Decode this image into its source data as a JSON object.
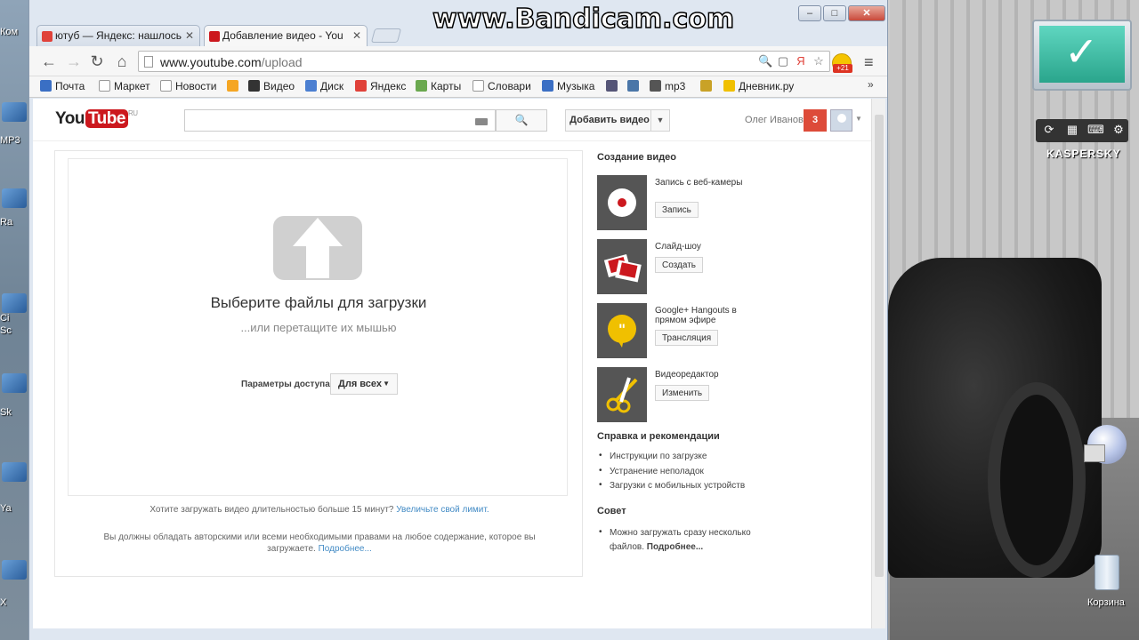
{
  "watermark": "www.Bandicam.com",
  "browser": {
    "tabs": [
      {
        "label": "ютуб — Яндекс: нашлось",
        "active": false,
        "favicon_color": "#e0423a"
      },
      {
        "label": "Добавление видео - You",
        "active": true,
        "favicon_color": "#cc181e"
      }
    ],
    "address": {
      "host": "www.youtube.com",
      "path": "/upload"
    },
    "extension_badge": "+21",
    "bookmarks": [
      {
        "label": "Почта",
        "icon": "mail-icon",
        "color": "#3a6fc4"
      },
      {
        "label": "Маркет",
        "icon": "page-icon",
        "color": "#ffffff"
      },
      {
        "label": "Новости",
        "icon": "page-icon",
        "color": "#ffffff"
      },
      {
        "label": "",
        "icon": "odnoklassniki-icon",
        "color": "#f5a623"
      },
      {
        "label": "Видео",
        "icon": "play-icon",
        "color": "#333333"
      },
      {
        "label": "Диск",
        "icon": "disk-icon",
        "color": "#4b7fd1"
      },
      {
        "label": "Яндекс",
        "icon": "yandex-icon",
        "color": "#e0423a"
      },
      {
        "label": "Карты",
        "icon": "maps-icon",
        "color": "#6aa84f"
      },
      {
        "label": "Словари",
        "icon": "page-icon",
        "color": "#ffffff"
      },
      {
        "label": "Музыка",
        "icon": "music-icon",
        "color": "#3b6fc4"
      },
      {
        "label": "",
        "icon": "globe-icon",
        "color": "#555577"
      },
      {
        "label": "",
        "icon": "vk-icon",
        "color": "#4a76a8"
      },
      {
        "label": "mp3",
        "icon": "mp3-icon",
        "color": "#555555"
      },
      {
        "label": "",
        "icon": "puzzle-icon",
        "color": "#c9a227"
      },
      {
        "label": "Дневник.ру",
        "icon": "diary-icon",
        "color": "#f0c000"
      }
    ]
  },
  "youtube": {
    "logo_you": "You",
    "logo_tube": "Tube",
    "logo_region": "RU",
    "search_placeholder": "",
    "upload_button": "Добавить видео",
    "user_name": "Олег Иванов",
    "notifications": "3",
    "upload": {
      "title": "Выберите файлы для загрузки",
      "subtitle": "...или перетащите их мышью",
      "access_label": "Параметры доступа:",
      "access_value": "Для всех",
      "note1_text": "Хотите загружать видео длительностью больше 15 минут?",
      "note1_link": "Увеличьте свой лимит.",
      "note2_text": "Вы должны обладать авторскими или всеми необходимыми правами на любое содержание, которое вы загружаете.",
      "note2_link": "Подробнее..."
    },
    "sidebar": {
      "create_title": "Создание видео",
      "create_items": [
        {
          "label": "Запись с веб-камеры",
          "button": "Запись",
          "thumb_color": "#555555"
        },
        {
          "label": "Слайд-шоу",
          "button": "Создать",
          "thumb_color": "#555555"
        },
        {
          "label": "Google+ Hangouts в прямом эфире",
          "button": "Трансляция",
          "thumb_color": "#555555"
        },
        {
          "label": "Видеоредактор",
          "button": "Изменить",
          "thumb_color": "#555555"
        }
      ],
      "help_title": "Справка и рекомендации",
      "help_links": [
        "Инструкции по загрузке",
        "Устранение неполадок",
        "Загрузки с мобильных устройств"
      ],
      "tip_title": "Совет",
      "tip_text": "Можно загружать сразу несколько файлов.",
      "tip_link": "Подробнее..."
    }
  },
  "desktop": {
    "left_labels": [
      "Ком",
      "MP3",
      "Ra",
      "Ci",
      "Sc",
      "Sk",
      "Ya",
      "X"
    ],
    "kaspersky_label": "KASPERSKY",
    "trash_label": "Корзина"
  }
}
